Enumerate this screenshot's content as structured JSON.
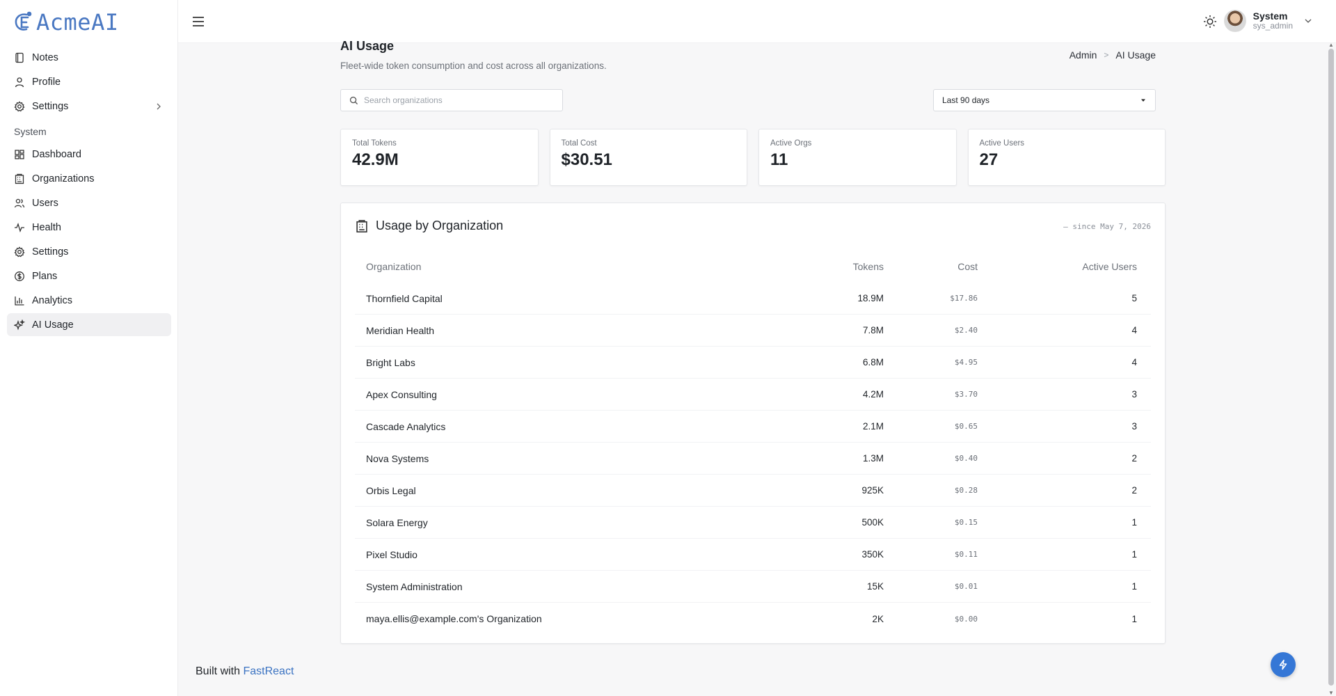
{
  "app": {
    "logo_text": "AcmeAI"
  },
  "sidebar": {
    "items": [
      {
        "label": "Notes",
        "icon": "notebook-icon"
      },
      {
        "label": "Profile",
        "icon": "user-icon"
      },
      {
        "label": "Settings",
        "icon": "gear-icon"
      }
    ],
    "section_label": "System",
    "system_items": [
      {
        "label": "Dashboard",
        "icon": "dashboard-icon"
      },
      {
        "label": "Organizations",
        "icon": "building-icon"
      },
      {
        "label": "Users",
        "icon": "users-icon"
      },
      {
        "label": "Health",
        "icon": "pulse-icon"
      },
      {
        "label": "Settings",
        "icon": "gear-icon"
      },
      {
        "label": "Plans",
        "icon": "dollar-icon"
      },
      {
        "label": "Analytics",
        "icon": "bar-chart-icon"
      },
      {
        "label": "AI Usage",
        "icon": "sparkles-icon",
        "active": true
      }
    ]
  },
  "topbar": {
    "user_name": "System",
    "user_role": "sys_admin"
  },
  "page": {
    "title": "AI Usage",
    "subtitle": "Fleet-wide token consumption and cost across all organizations.",
    "breadcrumb": [
      "Admin",
      "AI Usage"
    ]
  },
  "filters": {
    "search_placeholder": "Search organizations",
    "range_value": "Last 90 days"
  },
  "stats": [
    {
      "label": "Total Tokens",
      "value": "42.9M"
    },
    {
      "label": "Total Cost",
      "value": "$30.51"
    },
    {
      "label": "Active Orgs",
      "value": "11"
    },
    {
      "label": "Active Users",
      "value": "27"
    }
  ],
  "table": {
    "title": "Usage by Organization",
    "meta": "— since May 7, 2026",
    "columns": [
      "Organization",
      "Tokens",
      "Cost",
      "Active Users"
    ],
    "rows": [
      {
        "org": "Thornfield Capital",
        "tokens": "18.9M",
        "cost": "$17.86",
        "users": "5"
      },
      {
        "org": "Meridian Health",
        "tokens": "7.8M",
        "cost": "$2.40",
        "users": "4"
      },
      {
        "org": "Bright Labs",
        "tokens": "6.8M",
        "cost": "$4.95",
        "users": "4"
      },
      {
        "org": "Apex Consulting",
        "tokens": "4.2M",
        "cost": "$3.70",
        "users": "3"
      },
      {
        "org": "Cascade Analytics",
        "tokens": "2.1M",
        "cost": "$0.65",
        "users": "3"
      },
      {
        "org": "Nova Systems",
        "tokens": "1.3M",
        "cost": "$0.40",
        "users": "2"
      },
      {
        "org": "Orbis Legal",
        "tokens": "925K",
        "cost": "$0.28",
        "users": "2"
      },
      {
        "org": "Solara Energy",
        "tokens": "500K",
        "cost": "$0.15",
        "users": "1"
      },
      {
        "org": "Pixel Studio",
        "tokens": "350K",
        "cost": "$0.11",
        "users": "1"
      },
      {
        "org": "System Administration",
        "tokens": "15K",
        "cost": "$0.01",
        "users": "1"
      },
      {
        "org": "maya.ellis@example.com's Organization",
        "tokens": "2K",
        "cost": "$0.00",
        "users": "1"
      }
    ]
  },
  "footer": {
    "prefix": "Built with",
    "link": "FastReact"
  },
  "colors": {
    "accent": "#3577d6",
    "logo": "#4a78c2"
  }
}
